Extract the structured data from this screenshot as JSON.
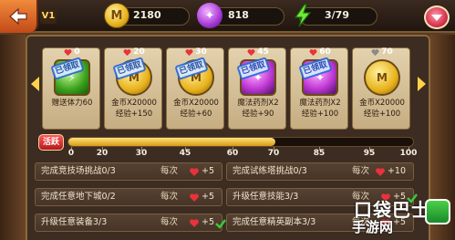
{
  "topbar": {
    "level": "V1",
    "gold": "2180",
    "potion": "818",
    "energy": "3/79"
  },
  "rewards": [
    {
      "cost": "0",
      "claimed": true,
      "item": "energy",
      "badge": "已领取",
      "line1": "赠送体力60",
      "line2": ""
    },
    {
      "cost": "20",
      "claimed": true,
      "item": "gold",
      "badge": "已领取",
      "line1": "金币X20000",
      "line2": "经验+150"
    },
    {
      "cost": "30",
      "claimed": true,
      "item": "gold",
      "badge": "已领取",
      "line1": "金币X20000",
      "line2": "经验+60"
    },
    {
      "cost": "45",
      "claimed": true,
      "item": "potion",
      "badge": "已领取",
      "line1": "魔法药剂X2",
      "line2": "经验+90"
    },
    {
      "cost": "60",
      "claimed": true,
      "item": "potion",
      "badge": "已领取",
      "line1": "魔法药剂X2",
      "line2": "经验+100"
    },
    {
      "cost": "70",
      "claimed": false,
      "item": "gold",
      "badge": "",
      "line1": "金币X20000",
      "line2": "经验+100"
    }
  ],
  "activity": {
    "label": "活跃",
    "progress": 60,
    "max": 100,
    "ticks": [
      "0",
      "20",
      "30",
      "45",
      "60",
      "70",
      "85",
      "95",
      "100"
    ]
  },
  "tasks": [
    {
      "name": "完成竞技场挑战0/3",
      "every": "每次",
      "reward": "+5",
      "done": false
    },
    {
      "name": "完成试练塔挑战0/3",
      "every": "每次",
      "reward": "+10",
      "done": false
    },
    {
      "name": "完成任意地下城0/2",
      "every": "每次",
      "reward": "+5",
      "done": false
    },
    {
      "name": "升级任意技能3/3",
      "every": "每次",
      "reward": "+5",
      "done": true
    },
    {
      "name": "升级任意装备3/3",
      "every": "每次",
      "reward": "+5",
      "done": true
    },
    {
      "name": "完成任意精英副本3/3",
      "every": "每次",
      "reward": "+5",
      "done": true
    }
  ],
  "watermark": {
    "line1": "口袋巴士",
    "line2": "手游网"
  },
  "colors": {
    "heart": "#e8323c",
    "heart_gray": "#8a8a8a",
    "check": "#3cc83c",
    "bar_fill": "#f0c040"
  }
}
